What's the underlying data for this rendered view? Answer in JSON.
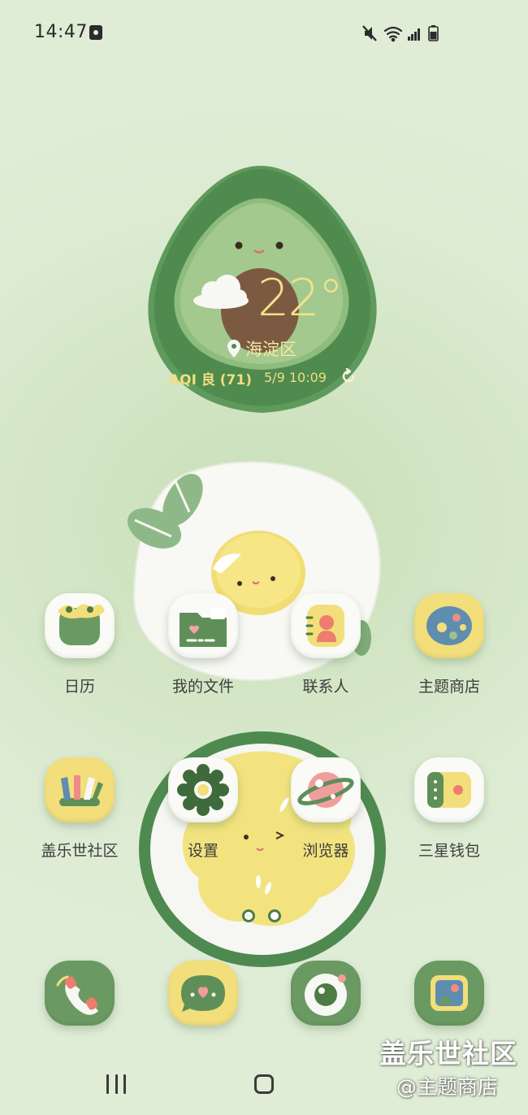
{
  "status_bar": {
    "time": "14:47",
    "icons": [
      "screen-record-icon",
      "mute-icon",
      "wifi-icon",
      "signal-icon",
      "battery-icon"
    ]
  },
  "weather": {
    "temperature": "22°",
    "location": "海淀区",
    "aqi": "AQI 良 (71)",
    "updated": "5/9 10:09",
    "condition_icon": "cloud-icon"
  },
  "apps": [
    {
      "label": "日历",
      "icon": "calendar-icon"
    },
    {
      "label": "我的文件",
      "icon": "folder-icon"
    },
    {
      "label": "联系人",
      "icon": "contacts-icon"
    },
    {
      "label": "主题商店",
      "icon": "palette-icon"
    },
    {
      "label": "盖乐世社区",
      "icon": "community-icon"
    },
    {
      "label": "设置",
      "icon": "gear-icon"
    },
    {
      "label": "浏览器",
      "icon": "planet-icon"
    },
    {
      "label": "三星钱包",
      "icon": "wallet-icon"
    }
  ],
  "dock": [
    {
      "icon": "phone-icon"
    },
    {
      "icon": "messages-icon"
    },
    {
      "icon": "camera-icon"
    },
    {
      "icon": "gallery-icon"
    }
  ],
  "pager": {
    "pages": 2,
    "current": 1
  },
  "watermark": {
    "line1": "盖乐世社区",
    "line2": "@主题商店"
  },
  "colors": {
    "accent_green": "#5e8f58",
    "accent_yellow": "#f3de7e",
    "background": "#d6e8c9"
  }
}
